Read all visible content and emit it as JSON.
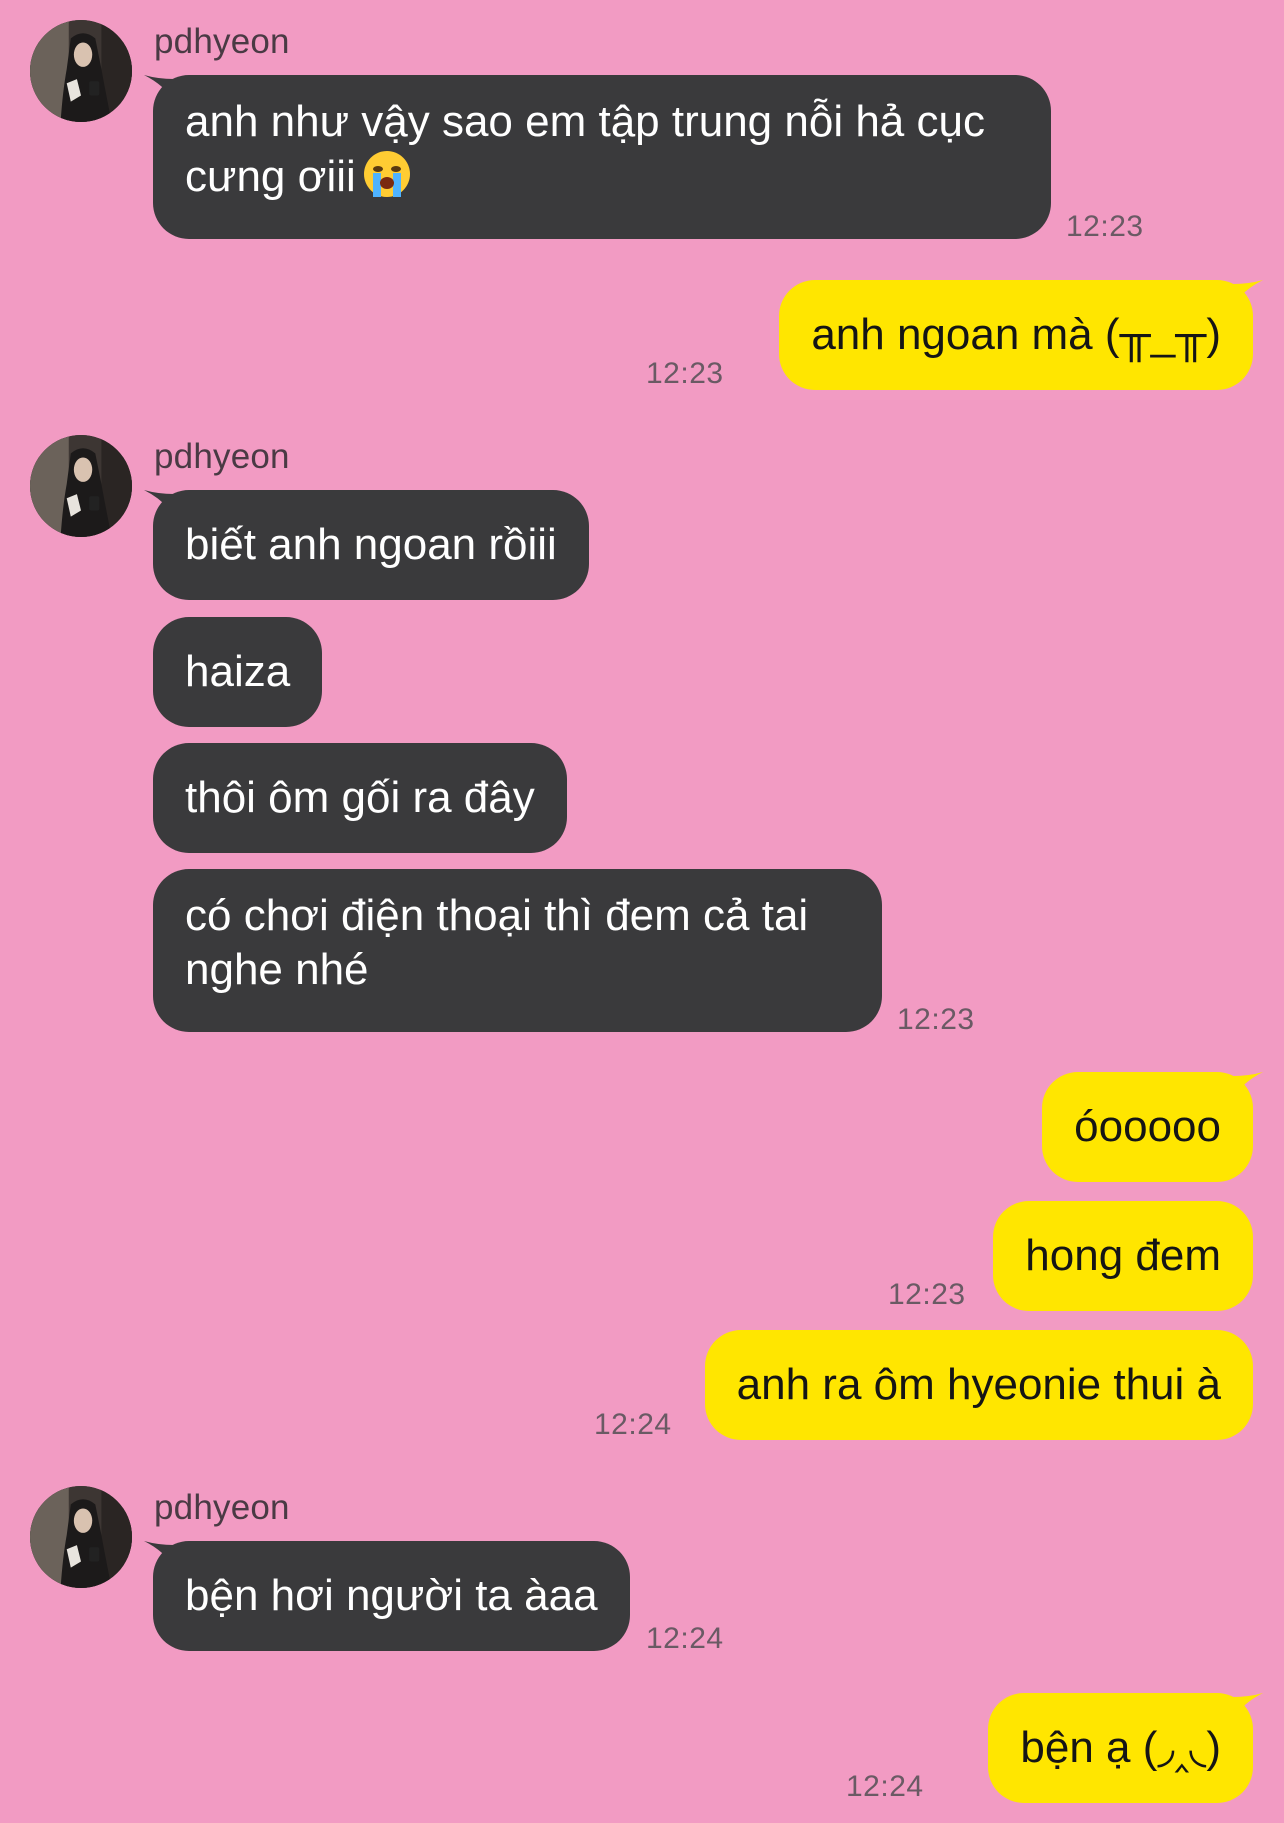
{
  "contact": {
    "name": "pdhyeon"
  },
  "messages": [
    {
      "id": "m1",
      "from": "in",
      "text_line1": "anh như vậy sao em tập trung nỗi hả cục",
      "text_line2": "cưng ơiii",
      "emoji": "crying-face",
      "time": "12:23"
    },
    {
      "id": "m2",
      "from": "out",
      "text": "anh ngoan mà (╥_╥)",
      "time": "12:23"
    },
    {
      "id": "m3",
      "from": "in",
      "text": "biết anh ngoan rồiii"
    },
    {
      "id": "m4",
      "from": "in",
      "text": "haiza"
    },
    {
      "id": "m5",
      "from": "in",
      "text": "thôi ôm gối ra đây"
    },
    {
      "id": "m6",
      "from": "in",
      "text_line1": "có chơi điện thoại thì đem cả tai",
      "text_line2": "nghe nhé",
      "time": "12:23"
    },
    {
      "id": "m7",
      "from": "out",
      "text": "óooooo"
    },
    {
      "id": "m8",
      "from": "out",
      "text": "hong đem",
      "time": "12:23"
    },
    {
      "id": "m9",
      "from": "out",
      "text": "anh ra ôm hyeonie thui à",
      "time": "12:24"
    },
    {
      "id": "m10",
      "from": "in",
      "text": "bện hơi người ta àaa",
      "time": "12:24"
    },
    {
      "id": "m11",
      "from": "out",
      "text": "bện ạ (◞‸◟)",
      "time": "12:24"
    }
  ],
  "colors": {
    "background": "#f29bc3",
    "incoming_bubble": "#3a3a3c",
    "outgoing_bubble": "#ffe600"
  }
}
